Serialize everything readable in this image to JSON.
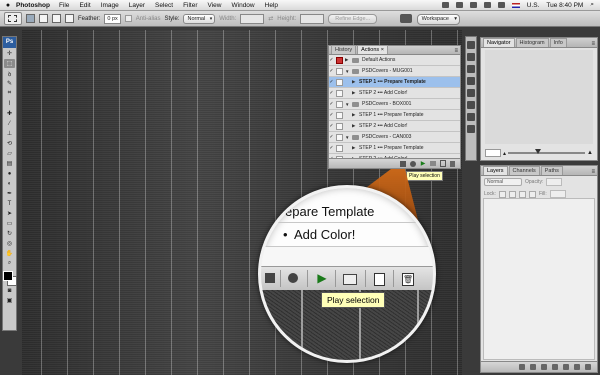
{
  "menubar": {
    "app_name": "Photoshop",
    "items": [
      "File",
      "Edit",
      "Image",
      "Layer",
      "Select",
      "Filter",
      "View",
      "Window",
      "Help"
    ],
    "input_locale": "U.S.",
    "clock": "Tue 8:40 PM"
  },
  "options_bar": {
    "feather_label": "Feather:",
    "feather_value": "0 px",
    "anti_alias_label": "Anti-alias",
    "style_label": "Style:",
    "style_value": "Normal",
    "width_label": "Width:",
    "height_label": "Height:",
    "refine_edge_label": "Refine Edge...",
    "workspace_label": "Workspace"
  },
  "toolbox": {
    "badge": "Ps"
  },
  "actions_panel": {
    "tabs": [
      "History",
      "Actions"
    ],
    "close_glyph": "×",
    "rows": [
      {
        "label": "Default Actions",
        "kind": "set",
        "expanded": false,
        "checked": true,
        "dialog_red": true,
        "selected": false
      },
      {
        "label": "PSDCovers - MUG001",
        "kind": "set",
        "expanded": true,
        "checked": true,
        "dialog_red": false,
        "selected": false
      },
      {
        "label": "STEP 1 ••• Prepare Template",
        "kind": "action",
        "expanded": false,
        "checked": true,
        "dialog_red": false,
        "selected": true
      },
      {
        "label": "STEP 2 ••• Add Color!",
        "kind": "action",
        "expanded": false,
        "checked": true,
        "dialog_red": false,
        "selected": false
      },
      {
        "label": "PSDCovers - BOX001",
        "kind": "set",
        "expanded": true,
        "checked": true,
        "dialog_red": false,
        "selected": false
      },
      {
        "label": "STEP 1 ••• Prepare Template",
        "kind": "action",
        "expanded": false,
        "checked": true,
        "dialog_red": false,
        "selected": false
      },
      {
        "label": "STEP 2 ••• Add Color!",
        "kind": "action",
        "expanded": false,
        "checked": true,
        "dialog_red": false,
        "selected": false
      },
      {
        "label": "PSDCovers - CAN003",
        "kind": "set",
        "expanded": true,
        "checked": true,
        "dialog_red": false,
        "selected": false
      },
      {
        "label": "STEP 1 ••• Prepare Template",
        "kind": "action",
        "expanded": false,
        "checked": true,
        "dialog_red": false,
        "selected": false
      },
      {
        "label": "STEP 2 ••• Add Color!",
        "kind": "action",
        "expanded": false,
        "checked": true,
        "dialog_red": false,
        "selected": false
      }
    ],
    "tooltip": "Play selection"
  },
  "navigator_panel": {
    "tabs": [
      "Navigator",
      "Histogram",
      "Info"
    ]
  },
  "layers_panel": {
    "tabs": [
      "Layers",
      "Channels",
      "Paths"
    ],
    "blend_mode": "Normal",
    "opacity_label": "Opacity:",
    "lock_label": "Lock:",
    "fill_label": "Fill:"
  },
  "callout": {
    "row1_text": "epare Template",
    "row2_bullet": "•",
    "row2_text": "Add Color!",
    "tooltip": "Play selection",
    "play_glyph": "▶",
    "trash_glyph": "🗑",
    "accent_color": "#c25a10"
  }
}
